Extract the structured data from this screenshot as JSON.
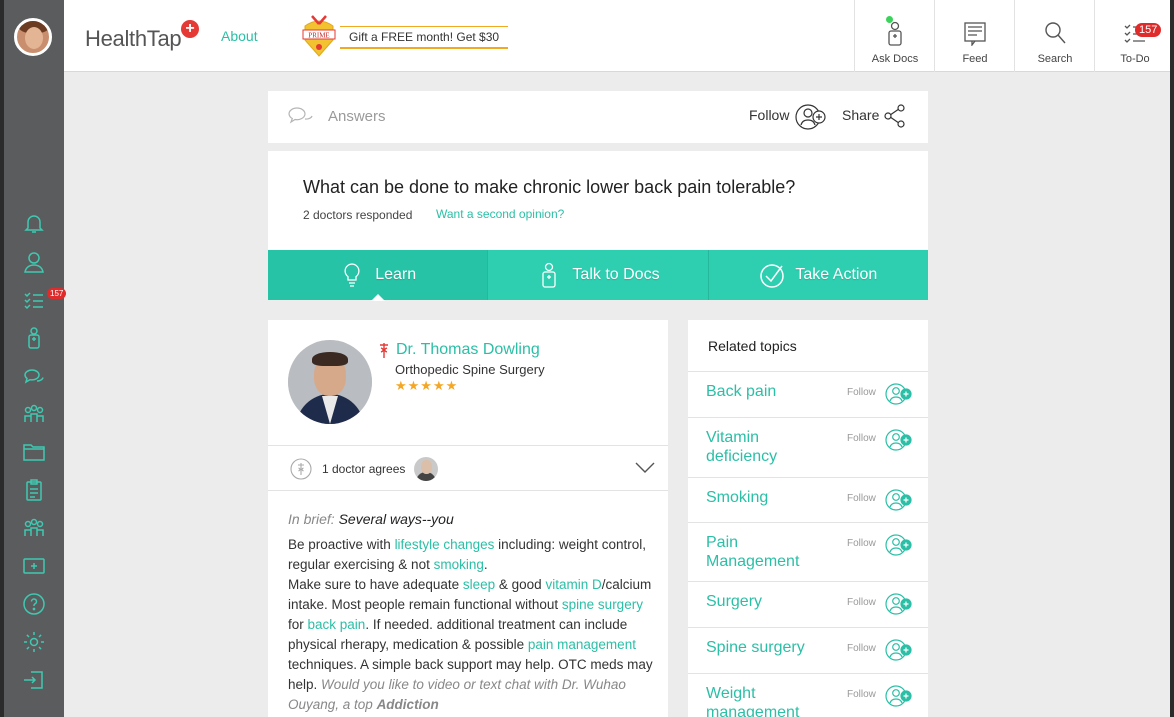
{
  "header": {
    "brand": "HealthTap",
    "about_label": "About",
    "prime_label": "PRIME",
    "gift_text": "Gift a FREE month! Get $30",
    "nav": [
      {
        "label": "Ask Docs",
        "icon": "doctor-icon"
      },
      {
        "label": "Feed",
        "icon": "feed-icon"
      },
      {
        "label": "Search",
        "icon": "search-icon"
      },
      {
        "label": "To-Do",
        "icon": "todo-icon",
        "badge": "157"
      }
    ]
  },
  "sidebar": {
    "todo_badge": "157",
    "icons": [
      "bell-icon",
      "profile-icon",
      "checklist-icon",
      "doctor-icon",
      "chat-icon",
      "community-icon",
      "folder-icon",
      "clipboard-icon",
      "group-icon",
      "health-card-icon",
      "help-icon",
      "settings-icon",
      "sign-out-icon"
    ]
  },
  "answers_bar": {
    "title": "Answers",
    "follow_label": "Follow",
    "share_label": "Share"
  },
  "question": {
    "title": "What can be done to make chronic lower back pain tolerable?",
    "responded": "2 doctors responded",
    "second_opinion": "Want a second opinion?",
    "tabs": [
      {
        "label": "Learn",
        "icon": "lightbulb-icon",
        "active": true
      },
      {
        "label": "Talk to Docs",
        "icon": "doctor-icon",
        "active": false
      },
      {
        "label": "Take Action",
        "icon": "checkmark-circle-icon",
        "active": false
      }
    ]
  },
  "answer": {
    "doctor_name": "Dr. Thomas Dowling",
    "specialty": "Orthopedic Spine Surgery",
    "stars": "★★★★★",
    "rating": 5,
    "agree_text": "1 doctor agrees",
    "brief_lead": "In brief:",
    "brief_title": "Several ways--you",
    "body": {
      "t1": "Be proactive with ",
      "l1": "lifestyle changes",
      "t2": " including: weight control, regular exercising & not ",
      "l2": "smoking",
      "t3": ".",
      "t4": "Make sure to have adequate ",
      "l3": "sleep",
      "t5": " & good ",
      "l4": "vitamin D",
      "t6": "/calcium intake. Most people remain functional without ",
      "l5": "spine surgery",
      "t7": " for ",
      "l6": "back pain",
      "t8": ". If needed. additional treatment can include physical rherapy, medication & possible ",
      "l7": "pain management",
      "t9": " techniques. A simple back support may help. OTC meds may help. ",
      "i1": "Would you like to video or text chat with Dr. Wuhao Ouyang, a top ",
      "b1": "Addiction"
    }
  },
  "related": {
    "title": "Related topics",
    "follow_label": "Follow",
    "items": [
      {
        "name": "Back pain"
      },
      {
        "name": "Vitamin deficiency"
      },
      {
        "name": "Smoking"
      },
      {
        "name": "Pain Management"
      },
      {
        "name": "Surgery"
      },
      {
        "name": "Spine surgery"
      },
      {
        "name": "Weight management"
      }
    ]
  },
  "colors": {
    "accent": "#2bbfa6",
    "tab_bg": "#2ecfb1",
    "sidebar_bg": "#5a5c5e",
    "badge": "#e02b2b",
    "star": "#f5a623"
  }
}
